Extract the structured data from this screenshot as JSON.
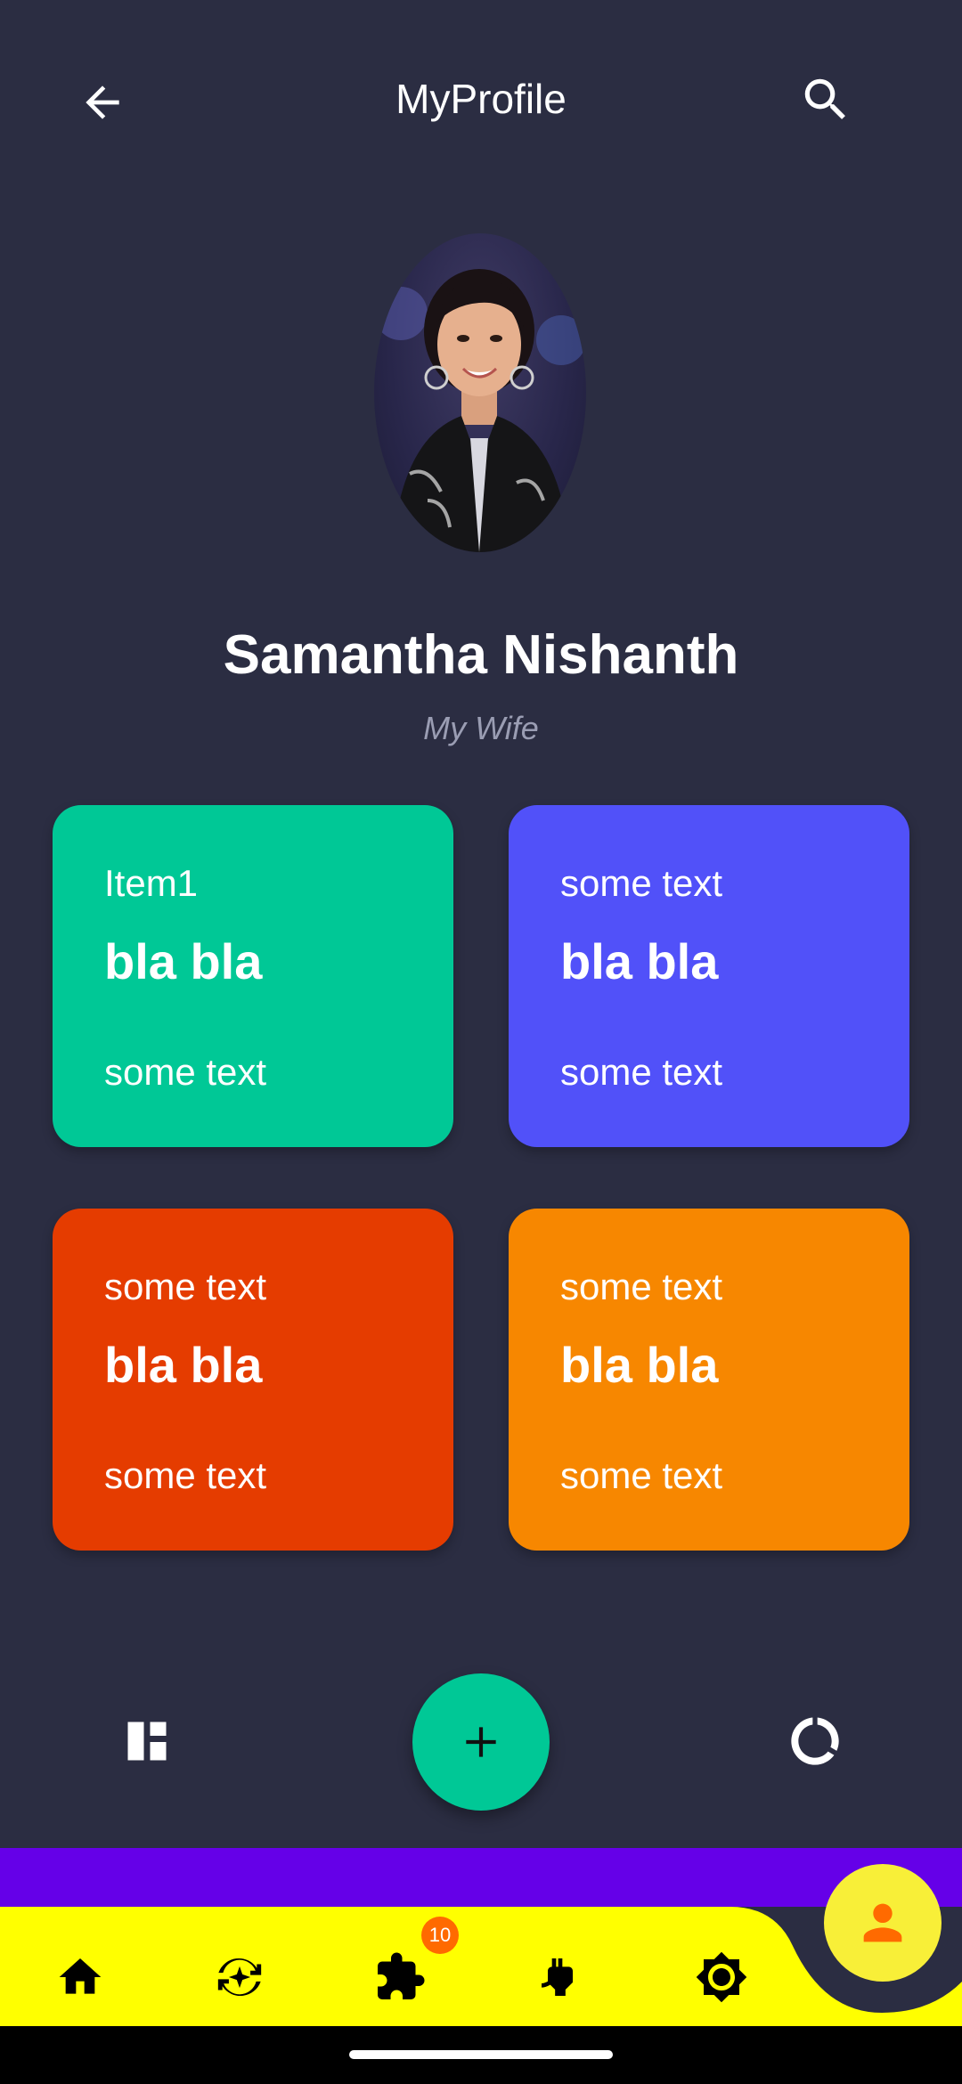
{
  "colors": {
    "background": "#2b2d42",
    "card_teal": "#00c896",
    "card_indigo": "#5151f9",
    "card_red": "#e53c00",
    "card_orange": "#f78700",
    "fab": "#00c896",
    "nav_purple": "#6500e8",
    "nav_yellow": "#ffff00",
    "profile_fab": "#f8ef38",
    "profile_icon": "#ff6a00",
    "badge": "#ff6a00"
  },
  "header": {
    "title": "MyProfile",
    "back_icon": "arrow-left-icon",
    "search_icon": "search-icon"
  },
  "profile": {
    "name": "Samantha Nishanth",
    "subtitle": "My Wife"
  },
  "cards": [
    {
      "top": "Item1",
      "middle": "bla bla",
      "bottom": "some text"
    },
    {
      "top": "some text",
      "middle": "bla bla",
      "bottom": "some text"
    },
    {
      "top": "some text",
      "middle": "bla bla",
      "bottom": "some text"
    },
    {
      "top": "some text",
      "middle": "bla bla",
      "bottom": "some text"
    }
  ],
  "actions": {
    "left_icon": "dashboard-icon",
    "fab_icon": "plus-icon",
    "right_icon": "donut-ring-icon"
  },
  "bottom_nav": {
    "items": [
      {
        "icon": "home-icon"
      },
      {
        "icon": "sync-sparkle-icon"
      },
      {
        "icon": "puzzle-icon",
        "badge": "10"
      },
      {
        "icon": "power-plug-icon"
      },
      {
        "icon": "brightness-icon"
      }
    ],
    "active_icon": "person-icon"
  }
}
